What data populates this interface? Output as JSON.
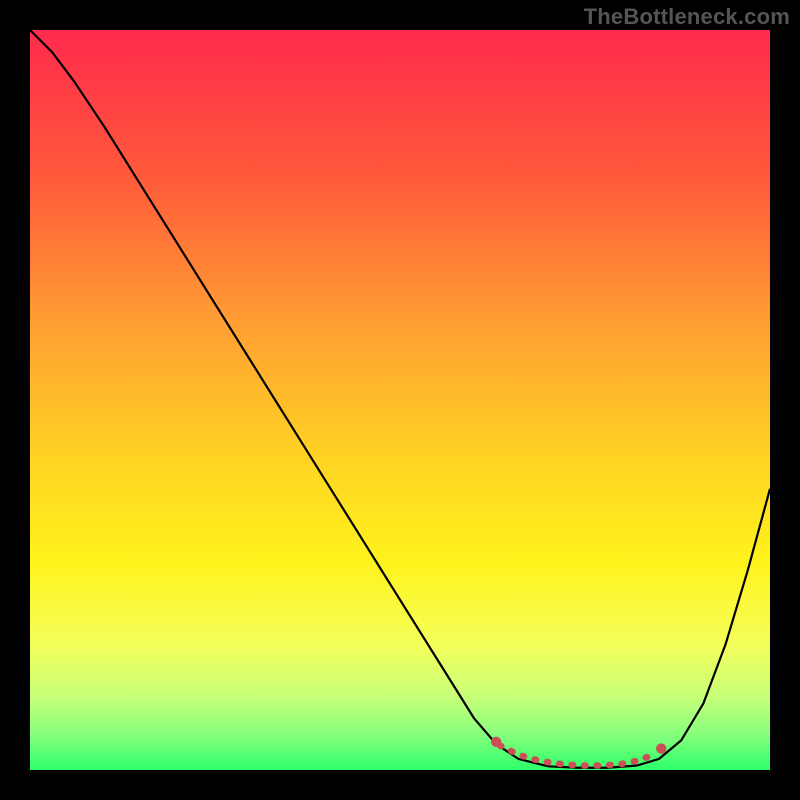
{
  "watermark": "TheBottleneck.com",
  "chart_data": {
    "type": "line",
    "title": "",
    "xlabel": "",
    "ylabel": "",
    "xlim": [
      0,
      100
    ],
    "ylim": [
      0,
      100
    ],
    "background_gradient_stops": [
      {
        "offset": 0.0,
        "color": "#ff2a4c"
      },
      {
        "offset": 0.2,
        "color": "#ff5a3a"
      },
      {
        "offset": 0.4,
        "color": "#ffa033"
      },
      {
        "offset": 0.58,
        "color": "#ffd323"
      },
      {
        "offset": 0.72,
        "color": "#fff31c"
      },
      {
        "offset": 0.83,
        "color": "#f4ff5a"
      },
      {
        "offset": 0.9,
        "color": "#c8ff78"
      },
      {
        "offset": 0.95,
        "color": "#8aff7d"
      },
      {
        "offset": 1.0,
        "color": "#2dff6a"
      }
    ],
    "series": [
      {
        "name": "value-curve",
        "stroke": "#000000",
        "stroke_width": 2.2,
        "x": [
          0,
          3,
          6,
          10,
          15,
          20,
          25,
          30,
          35,
          40,
          45,
          50,
          55,
          60,
          63,
          66,
          70,
          74,
          78,
          82,
          85,
          88,
          91,
          94,
          97,
          100
        ],
        "y": [
          100,
          97,
          93,
          87,
          79,
          71,
          63,
          55,
          47,
          39,
          31,
          23,
          15,
          7,
          3.5,
          1.5,
          0.5,
          0.3,
          0.3,
          0.6,
          1.5,
          4,
          9,
          17,
          27,
          38
        ]
      },
      {
        "name": "optimal-band-marker",
        "stroke": "#cc4f55",
        "stroke_width": 6.5,
        "dash": "1.5 11",
        "linecap": "round",
        "x": [
          63.5,
          66.2,
          69.0,
          71.8,
          74.5,
          77.2,
          79.8,
          82.3,
          84.5
        ],
        "y": [
          3.3,
          2.0,
          1.2,
          0.8,
          0.6,
          0.6,
          0.8,
          1.3,
          2.2
        ]
      }
    ],
    "optimal_endpoint_dots": {
      "color": "#cc4f55",
      "radius_px": 5.2,
      "points": [
        {
          "x": 63.0,
          "y": 3.8
        },
        {
          "x": 85.3,
          "y": 2.9
        }
      ]
    }
  }
}
